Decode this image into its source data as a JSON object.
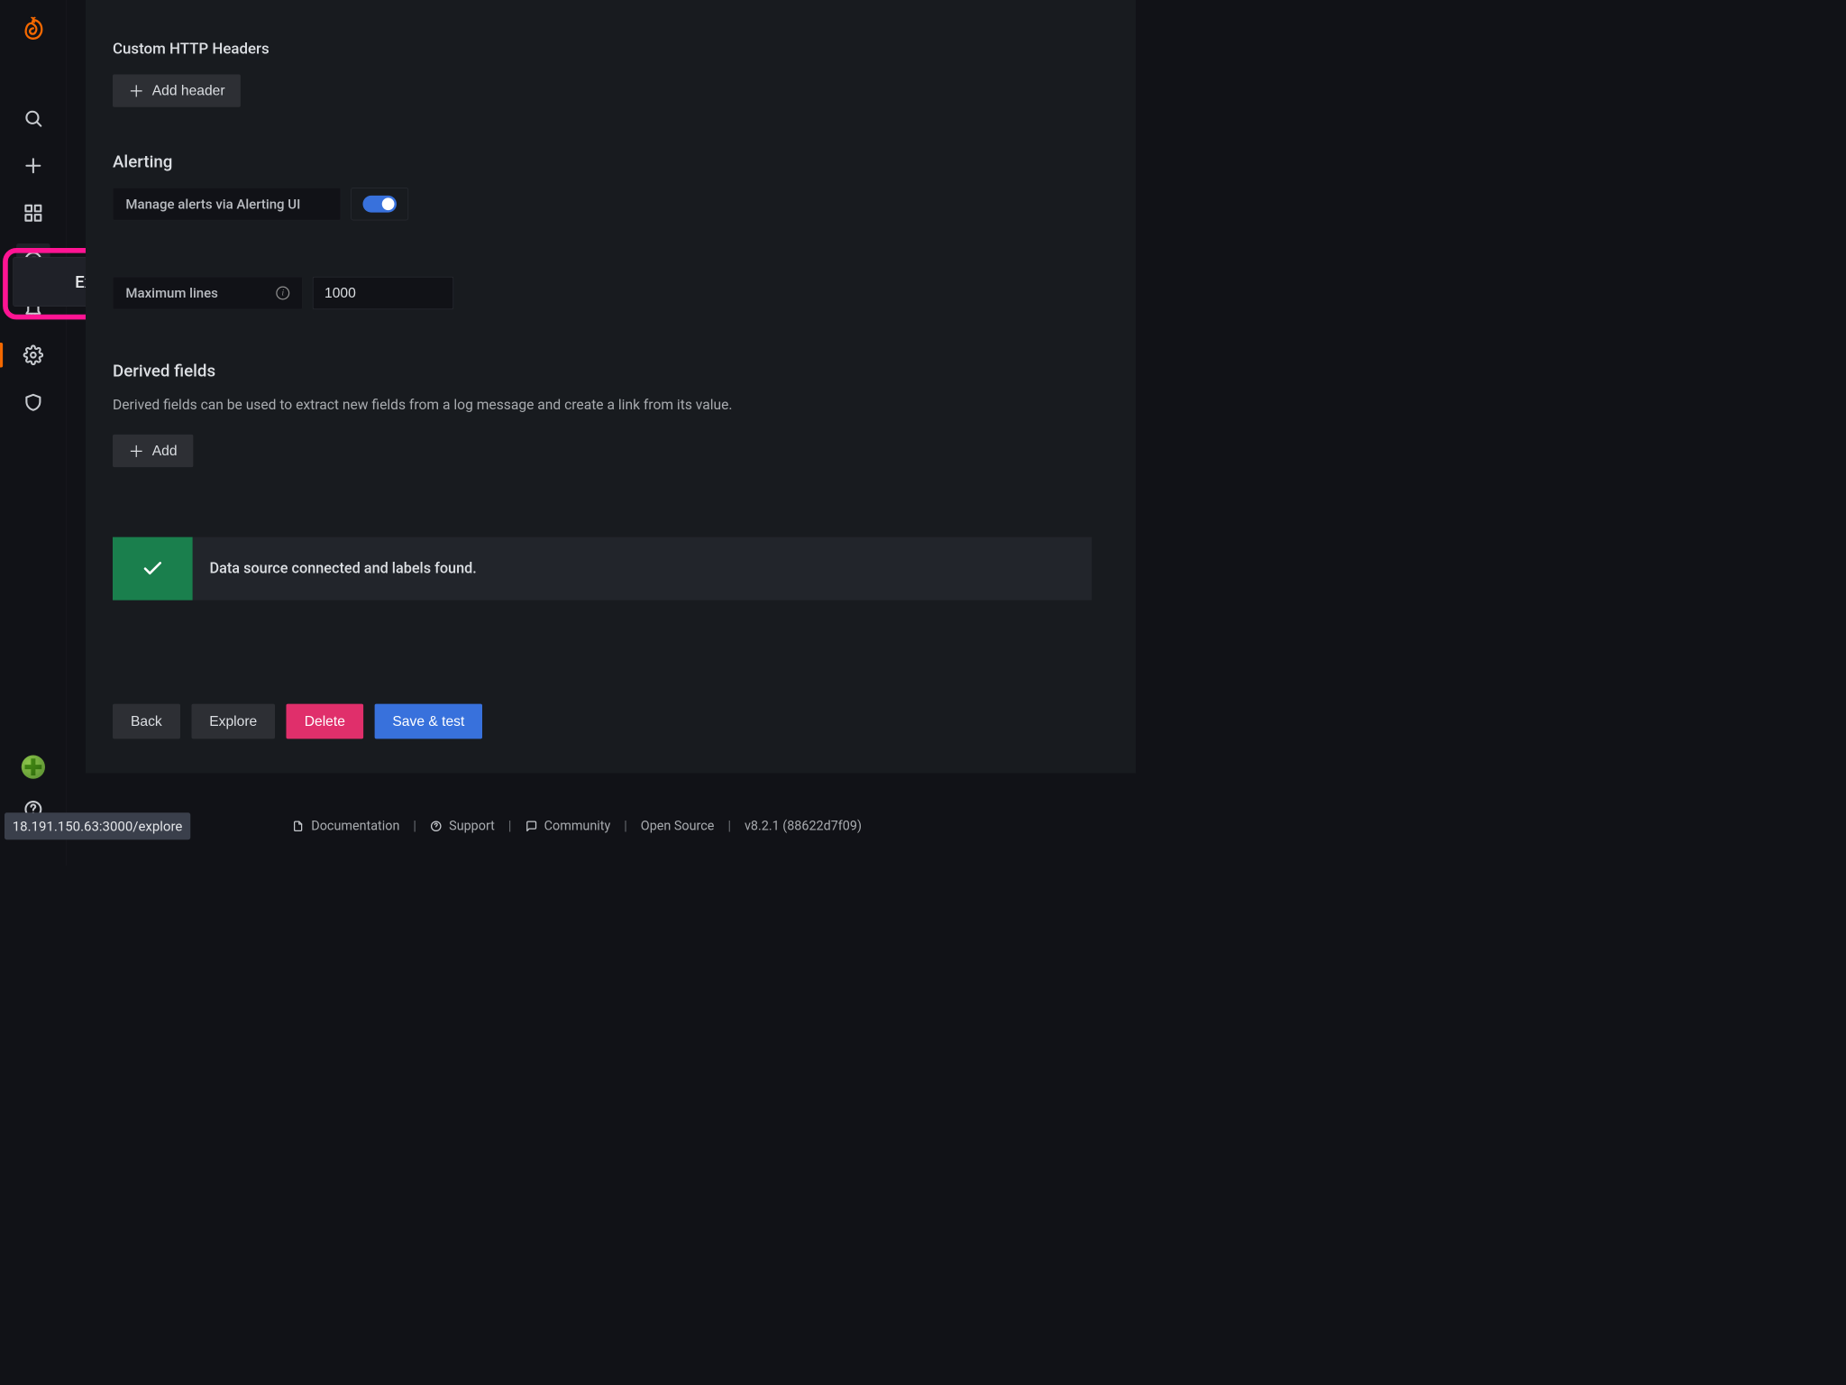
{
  "sidebar": {
    "explore_label": "Explore"
  },
  "http_headers": {
    "title": "Custom HTTP Headers",
    "add_label": "Add header"
  },
  "alerting": {
    "title": "Alerting",
    "manage_label": "Manage alerts via Alerting UI",
    "max_lines_label": "Maximum lines",
    "max_lines_value": "1000"
  },
  "derived": {
    "title": "Derived fields",
    "description": "Derived fields can be used to extract new fields from a log message and create a link from its value.",
    "add_label": "Add"
  },
  "status": {
    "success_message": "Data source connected and labels found."
  },
  "actions": {
    "back": "Back",
    "explore": "Explore",
    "delete": "Delete",
    "save_test": "Save & test"
  },
  "footer": {
    "documentation": "Documentation",
    "support": "Support",
    "community": "Community",
    "open_source": "Open Source",
    "version": "v8.2.1 (88622d7f09)"
  },
  "url_preview": "18.191.150.63:3000/explore"
}
